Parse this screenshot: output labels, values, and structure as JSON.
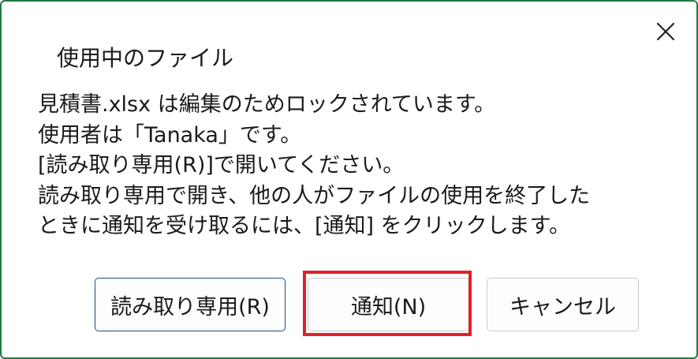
{
  "dialog": {
    "title": "使用中のファイル",
    "message_lines": [
      "見積書.xlsx は編集のためロックされています。",
      "使用者は「Tanaka」です。",
      "[読み取り専用(R)]で開いてください。",
      "読み取り専用で開き、他の人がファイルの使用を終了した",
      "ときに通知を受け取るには、[通知] をクリックします。"
    ],
    "close_icon": "close-icon"
  },
  "buttons": {
    "readonly_label": "読み取り専用(R)",
    "notify_label": "通知(N)",
    "cancel_label": "キャンセル"
  },
  "colors": {
    "border": "#1f7a43",
    "highlight": "#e0202b",
    "focus_border": "#1f4e79"
  }
}
